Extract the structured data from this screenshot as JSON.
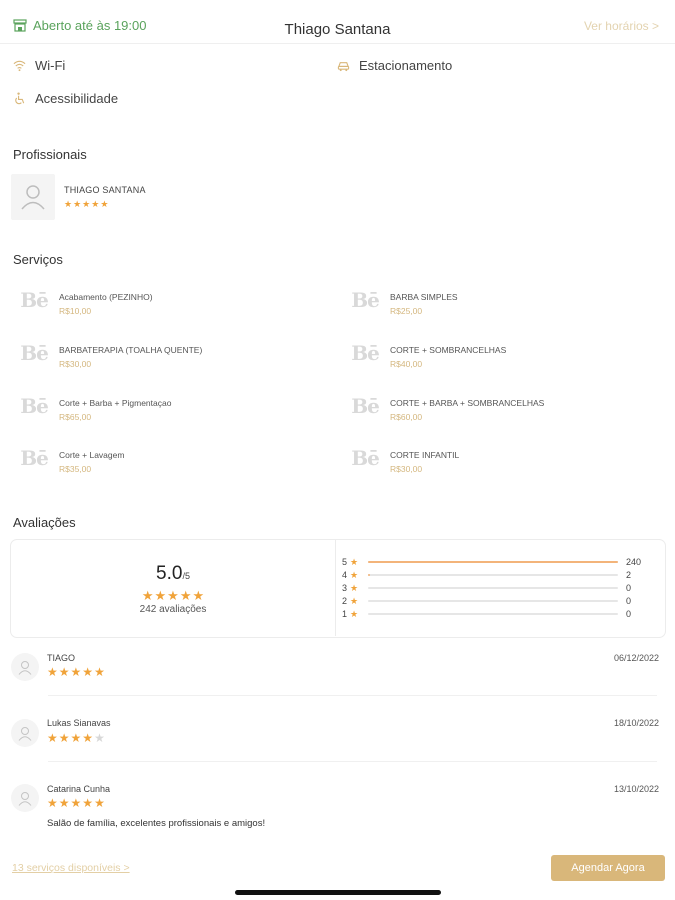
{
  "header": {
    "open_status": "Aberto até às 19:00",
    "title": "Thiago Santana",
    "hours_link": "Ver horários >"
  },
  "amenities": [
    {
      "label": "Wi-Fi",
      "icon": "wifi-icon"
    },
    {
      "label": "Estacionamento",
      "icon": "car-icon"
    },
    {
      "label": "Acessibilidade",
      "icon": "wheelchair-icon"
    }
  ],
  "professionals": {
    "title": "Profissionais",
    "items": [
      {
        "name": "THIAGO SANTANA",
        "rating": 5
      }
    ]
  },
  "services": {
    "title": "Serviços",
    "items": [
      {
        "name": "Acabamento (PEZINHO)",
        "price": "R$10,00"
      },
      {
        "name": "BARBA SIMPLES",
        "price": "R$25,00"
      },
      {
        "name": "BARBATERAPIA (TOALHA QUENTE)",
        "price": "R$30,00"
      },
      {
        "name": "CORTE  + SOMBRANCELHAS",
        "price": "R$40,00"
      },
      {
        "name": "Corte + Barba + Pigmentaçao",
        "price": "R$65,00"
      },
      {
        "name": "CORTE + BARBA + SOMBRANCELHAS",
        "price": "R$60,00"
      },
      {
        "name": "Corte + Lavagem",
        "price": "R$35,00"
      },
      {
        "name": "CORTE INFANTIL",
        "price": "R$30,00"
      }
    ]
  },
  "reviews_summary": {
    "title": "Avaliações",
    "score": "5.0",
    "score_suffix": "/5",
    "rating": 5,
    "count_label": "242 avaliações",
    "distribution": [
      {
        "stars": "5",
        "count": 240
      },
      {
        "stars": "4",
        "count": 2
      },
      {
        "stars": "3",
        "count": 0
      },
      {
        "stars": "2",
        "count": 0
      },
      {
        "stars": "1",
        "count": 0
      }
    ]
  },
  "reviews": [
    {
      "name": "TIAGO",
      "date": "06/12/2022",
      "rating": 5,
      "comment": ""
    },
    {
      "name": "Lukas Sianavas",
      "date": "18/10/2022",
      "rating": 4,
      "comment": ""
    },
    {
      "name": "Catarina Cunha",
      "date": "13/10/2022",
      "rating": 5,
      "comment": "Salão de família, excelentes profissionais e amigos!"
    }
  ],
  "footer": {
    "available_link": "13 serviços disponíveis >",
    "cta": "Agendar Agora"
  },
  "colors": {
    "accent": "#d9b77a",
    "star": "#f0a33a",
    "open": "#5aa35c"
  }
}
